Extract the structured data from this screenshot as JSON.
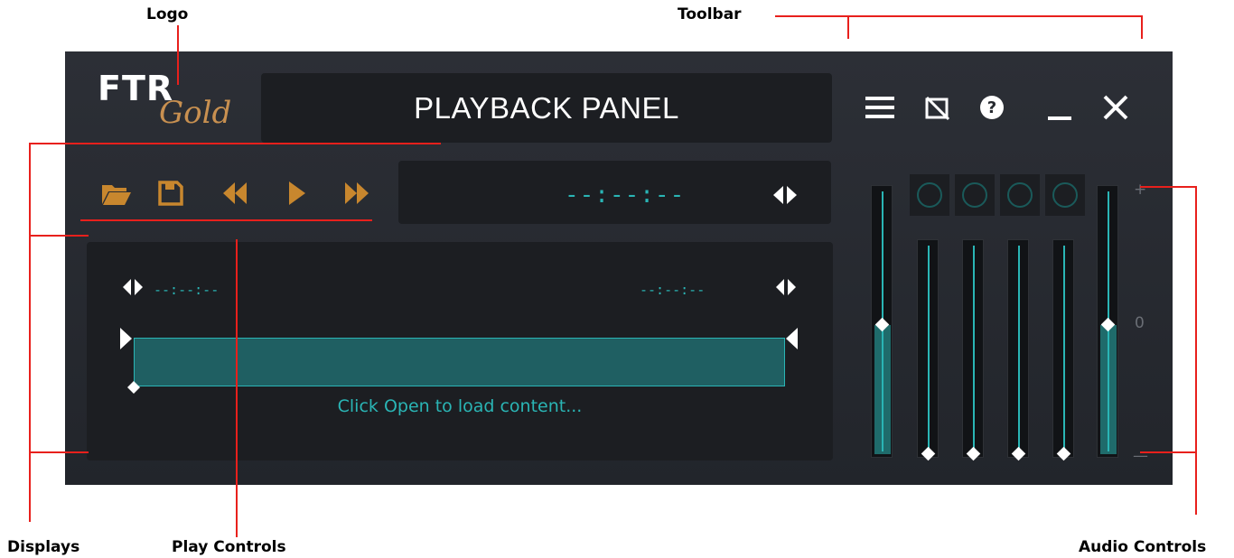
{
  "callouts": {
    "logo": "Logo",
    "toolbar": "Toolbar",
    "displays": "Displays",
    "play_controls": "Play Controls",
    "audio_controls": "Audio Controls"
  },
  "logo": {
    "primary": "FTR",
    "secondary": "Gold"
  },
  "title": "PLAYBACK PANEL",
  "toolbar": {
    "icons": [
      "menu-icon",
      "no-image-icon",
      "help-icon",
      "minimize-icon",
      "close-icon"
    ]
  },
  "play_controls": {
    "icons": [
      "open-folder-icon",
      "save-icon",
      "rewind-icon",
      "play-icon",
      "fast-forward-icon"
    ]
  },
  "display": {
    "main_timecode": "--:--:--",
    "start_timecode": "--:--:--",
    "end_timecode": "--:--:--",
    "status": "Click Open to load content..."
  },
  "audio": {
    "scale_top": "+",
    "scale_mid": "0",
    "scale_bottom": "—",
    "master_left_level": 0.5,
    "master_right_level": 0.5,
    "channel_levels": [
      0,
      0,
      0,
      0
    ]
  },
  "colors": {
    "accent_teal": "#2ab5b5",
    "play_control_orange": "#c8872e",
    "panel_bg": "#1c1e22",
    "callout_line": "#e8201c"
  }
}
